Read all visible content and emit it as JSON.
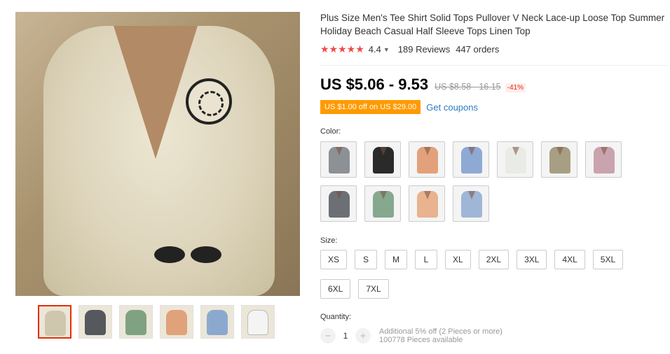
{
  "product": {
    "title": "Plus Size Men's Tee Shirt Solid Tops Pullover V Neck Lace-up Loose Top Summer Holiday Beach Casual Half Sleeve Tops Linen Top",
    "rating": "4.4",
    "stars": "★★★★★",
    "reviews": "189 Reviews",
    "orders": "447 orders",
    "price": "US $5.06 - 9.53",
    "old_price": "US $8.58 - 16.15",
    "discount": "-41%",
    "coupon": "US $1.00 off on US $29.00",
    "get_coupons": "Get coupons"
  },
  "gallery": {
    "thumbnails": [
      {
        "color": "#cfc7ad",
        "active": true
      },
      {
        "color": "#55585c",
        "active": false
      },
      {
        "color": "#7fa283",
        "active": false
      },
      {
        "color": "#e0a27a",
        "active": false
      },
      {
        "color": "#8ba9cf",
        "active": false
      },
      {
        "color": "#f4f4f4",
        "active": false
      }
    ]
  },
  "color": {
    "label": "Color:",
    "options": [
      {
        "name": "gray",
        "color": "#8c9196"
      },
      {
        "name": "black",
        "color": "#2a2a2a"
      },
      {
        "name": "orange",
        "color": "#e3a17b"
      },
      {
        "name": "blue",
        "color": "#8ea9d4"
      },
      {
        "name": "white",
        "color": "#e9ebe7"
      },
      {
        "name": "khaki",
        "color": "#a79e83"
      },
      {
        "name": "pink",
        "color": "#c9a3ad"
      },
      {
        "name": "dark-gray",
        "color": "#6c7075"
      },
      {
        "name": "green",
        "color": "#86a88f"
      },
      {
        "name": "light-orange",
        "color": "#e9b38f"
      },
      {
        "name": "light-blue",
        "color": "#9fb6d6"
      }
    ]
  },
  "size": {
    "label": "Size:",
    "options": [
      "XS",
      "S",
      "M",
      "L",
      "XL",
      "2XL",
      "3XL",
      "4XL",
      "5XL",
      "6XL",
      "7XL"
    ]
  },
  "quantity": {
    "label": "Quantity:",
    "value": "1",
    "minus": "−",
    "plus": "+",
    "note": "Additional 5% off (2 Pieces or more)",
    "available": "100778 Pieces available"
  }
}
